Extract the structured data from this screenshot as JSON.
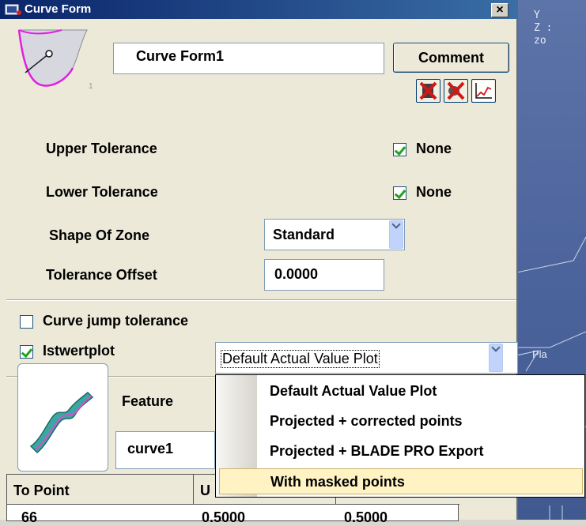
{
  "window": {
    "title": "Curve Form",
    "close_glyph": "×"
  },
  "header": {
    "name_value": "Curve Form1",
    "comment_label": "Comment",
    "thumb_badge": "1"
  },
  "tolerances": {
    "upper_label": "Upper Tolerance",
    "upper_none_label": "None",
    "upper_none_checked": true,
    "lower_label": "Lower Tolerance",
    "lower_none_label": "None",
    "lower_none_checked": true,
    "shape_label": "Shape Of Zone",
    "shape_value": "Standard",
    "offset_label": "Tolerance Offset",
    "offset_value": "0.0000"
  },
  "options": {
    "jump_label": "Curve jump tolerance",
    "jump_checked": false,
    "istwert_label": "Istwertplot",
    "istwert_checked": true,
    "plot_value": "Default Actual Value Plot"
  },
  "feature": {
    "label": "Feature",
    "value": "curve1"
  },
  "table": {
    "headers": [
      "To Point",
      "U",
      ""
    ],
    "row": [
      "66",
      "0.5000",
      "0.5000"
    ]
  },
  "dropdown": {
    "items": [
      "Default Actual Value Plot",
      "Projected + corrected points",
      "Projected + BLADE PRO Export",
      "With masked points"
    ],
    "selected_index": 3
  },
  "viewport": {
    "lines": [
      "Y",
      "Z :",
      "zo"
    ],
    "label": "Pla"
  },
  "icons": [
    "curve-form-icon",
    "close-icon",
    "delete-icon",
    "cancel-icon",
    "plot-icon",
    "check-icon",
    "chevron-down-icon",
    "feature-curve-icon"
  ]
}
